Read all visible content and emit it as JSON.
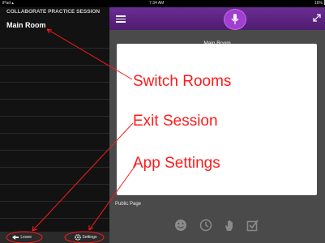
{
  "status_bar": {
    "device": "iPad",
    "time": "7:34 AM",
    "battery": "16%"
  },
  "sidebar": {
    "title": "COLLABORATE PRACTICE SESSION",
    "room": "Main Room"
  },
  "bottom_bar": {
    "leave_label": "Leave",
    "settings_label": "Settings"
  },
  "main": {
    "title": "Main Room",
    "public_page_label": "Public Page"
  },
  "annotations": {
    "switch_rooms": "Switch Rooms",
    "exit_session": "Exit Session",
    "app_settings": "App Settings"
  },
  "colors": {
    "accent_purple": "#5b2380",
    "mic_purple": "#a13fd0",
    "annotation_red": "#ff1a1a"
  },
  "icons": [
    "menu-icon",
    "microphone-icon",
    "expand-icon",
    "leave-icon",
    "gear-icon",
    "emoticon-icon",
    "clock-icon",
    "raise-hand-icon",
    "checkbox-icon",
    "wifi-icon"
  ]
}
